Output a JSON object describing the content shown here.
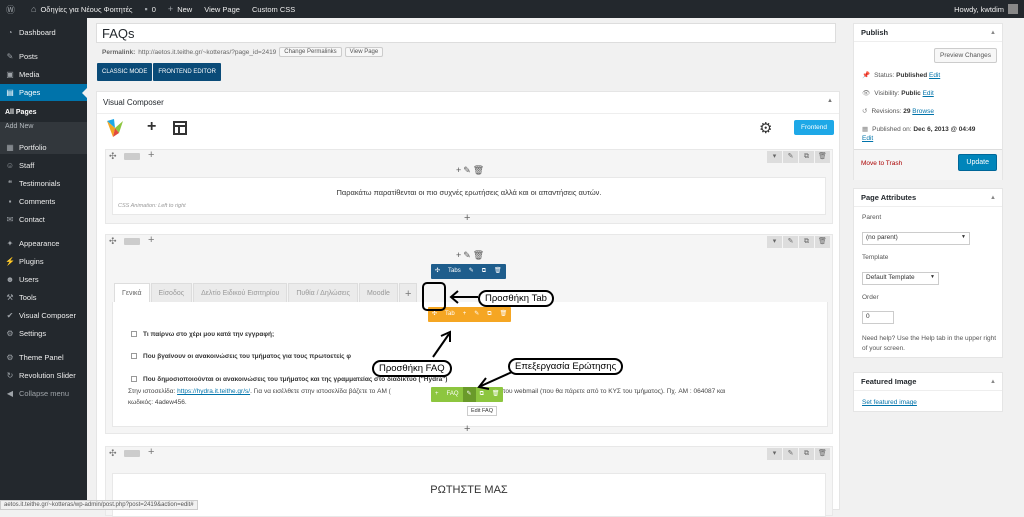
{
  "adminbar": {
    "wp": "W",
    "site": "Οδηγίες για Νέους Φοιτητές",
    "comments": "0",
    "new": "New",
    "view": "View Page",
    "css": "Custom CSS",
    "howdy": "Howdy, kwtdim"
  },
  "menu": {
    "dashboard": "Dashboard",
    "posts": "Posts",
    "media": "Media",
    "pages": "Pages",
    "all_pages": "All Pages",
    "add_new": "Add New",
    "portfolio": "Portfolio",
    "staff": "Staff",
    "testimonials": "Testimonials",
    "comments": "Comments",
    "contact": "Contact",
    "appearance": "Appearance",
    "plugins": "Plugins",
    "users": "Users",
    "tools": "Tools",
    "vc": "Visual Composer",
    "settings": "Settings",
    "theme": "Theme Panel",
    "rev": "Revolution Slider",
    "collapse": "Collapse menu"
  },
  "post": {
    "title": "FAQs",
    "permalink_label": "Permalink:",
    "permalink": "http://aetos.it.teithe.gr/~kotteras/?page_id=2419",
    "change_perm": "Change Permalinks",
    "view_page": "View Page",
    "classic": "CLASSIC MODE",
    "frontend": "FRONTEND EDITOR"
  },
  "vc": {
    "title": "Visual Composer",
    "frontend": "Frontend",
    "row1_text": "Παρακάτω παρατίθενται οι πιο συχνές ερωτήσεις αλλά και οι απαντήσεις αυτών.",
    "row1_anim": "CSS Animation: Left to right",
    "tabs": [
      "Γενικά",
      "Είσοδος",
      "Δελτίο Ειδικού Εισιτηρίου",
      "Πυθία / Δηλώσεις",
      "Moodle"
    ],
    "tabctl": "Tabs",
    "tabctl2": "Tab",
    "faqctl": "FAQ",
    "faqs": [
      "Τι παίρνω στο χέρι μου κατά την εγγραφή;",
      "Που βγαίνουν οι ανακοινώσεις του τμήματος για τους πρωτοετείς φ",
      "Που δημοσιοποιούνται οι ανακοινώσεις του τμήματος και της γραμματείας στο διαδίκτυο (\"Hydra\")"
    ],
    "answer_pre": "Στην ιστοσελίδα: ",
    "answer_link": "https://hydra.it.teithe.gr/s/",
    "answer_mid": ". Για να εισέλθετε στην ιστοσελίδα βάζετε το AM (",
    "answer_post": " και τον κωδικό του webmail (που θα  πάρετε από το ΚΥΣ του τμήματος). Πχ. AM : 064087 και",
    "answer_line2": "κωδικός: 4adew456.",
    "tooltip": "Edit FAQ",
    "row3_text": "ΡΩΤΗΣΤΕ ΜΑΣ"
  },
  "callouts": {
    "tab": "Προσθήκη Tab",
    "faq": "Προσθήκη FAQ",
    "edit": "Επεξεργασία Ερώτησης"
  },
  "publish": {
    "title": "Publish",
    "preview": "Preview Changes",
    "status_label": "Status:",
    "status": "Published",
    "visibility_label": "Visibility:",
    "visibility": "Public",
    "revisions_label": "Revisions:",
    "revisions": "29",
    "browse": "Browse",
    "published_label": "Published on:",
    "published": "Dec 6, 2013 @ 04:49",
    "edit": "Edit",
    "trash": "Move to Trash",
    "update": "Update"
  },
  "attributes": {
    "title": "Page Attributes",
    "parent": "Parent",
    "parent_val": "(no parent)",
    "template": "Template",
    "template_val": "Default Template",
    "order": "Order",
    "order_val": "0",
    "help": "Need help? Use the Help tab in the upper right of your screen."
  },
  "featured": {
    "title": "Featured Image",
    "link": "Set featured image"
  },
  "statusbar": "aetos.it.teithe.gr/~kotteras/wp-admin/post.php?post=2419&action=edit#",
  "colors": {
    "wpblue": "#0073aa",
    "adminbar": "#23282d",
    "tabctl": "#1e5d8c",
    "tabctl_orange": "#f5a623",
    "faqctl_green": "#8dc63f",
    "frontend": "#1ea8e7"
  }
}
